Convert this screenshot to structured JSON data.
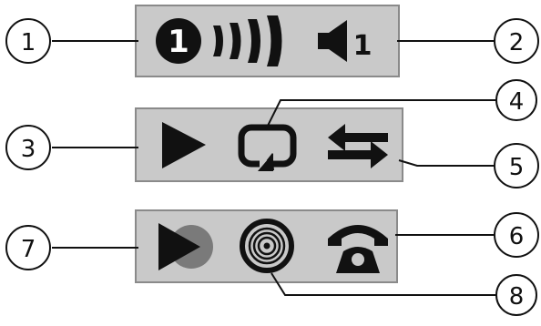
{
  "callouts": [
    "1",
    "2",
    "3",
    "4",
    "5",
    "6",
    "7",
    "8"
  ],
  "panels": [
    {
      "id": "top",
      "station_badge": "1",
      "volume_level": "1"
    },
    {
      "id": "middle"
    },
    {
      "id": "bottom"
    }
  ],
  "colors": {
    "panel_fill": "#c9c9c9",
    "panel_border": "#8a8a8a",
    "icon": "#111111",
    "record_dot": "#7a7a7a"
  },
  "icons": [
    "station-number-icon",
    "signal-strength-icon",
    "speaker-icon",
    "play-icon",
    "repeat-icon",
    "swap-arrows-icon",
    "play-record-icon",
    "disc-icon",
    "telephone-icon"
  ]
}
